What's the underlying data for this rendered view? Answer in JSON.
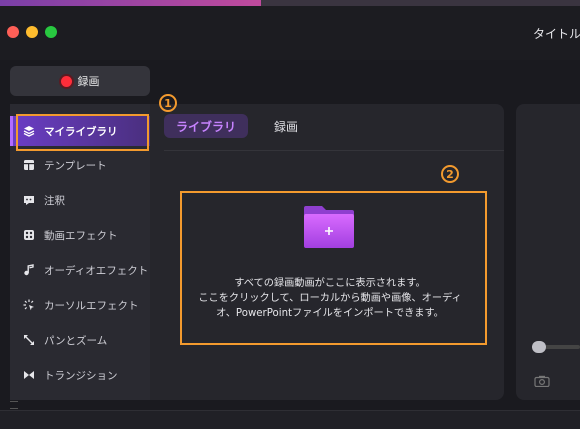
{
  "window": {
    "title": "タイトル"
  },
  "colors": {
    "accent": "#b26cff",
    "annotation": "#f39a2e",
    "record": "#ff2d3a"
  },
  "record_button": {
    "label": "録画"
  },
  "sidebar": {
    "items": [
      {
        "label": "マイライブラリ",
        "icon": "library-stack-icon",
        "active": true
      },
      {
        "label": "テンプレート",
        "icon": "template-icon"
      },
      {
        "label": "注釈",
        "icon": "annotation-icon"
      },
      {
        "label": "動画エフェクト",
        "icon": "video-effect-icon"
      },
      {
        "label": "オーディオエフェクト",
        "icon": "audio-effect-icon"
      },
      {
        "label": "カーソルエフェクト",
        "icon": "cursor-effect-icon"
      },
      {
        "label": "パンとズーム",
        "icon": "pan-zoom-icon"
      },
      {
        "label": "トランジション",
        "icon": "transition-icon"
      }
    ]
  },
  "tabs": [
    {
      "label": "ライブラリ",
      "active": true
    },
    {
      "label": "録画"
    }
  ],
  "empty_state": {
    "line1": "すべての録画動画がここに表示されます。",
    "line2": "ここをクリックして、ローカルから動画や画像、オーディ",
    "line3": "オ、PowerPointファイルをインポートできます。",
    "icon": "folder-add-icon"
  },
  "annotations": {
    "one": "1",
    "two": "2"
  }
}
